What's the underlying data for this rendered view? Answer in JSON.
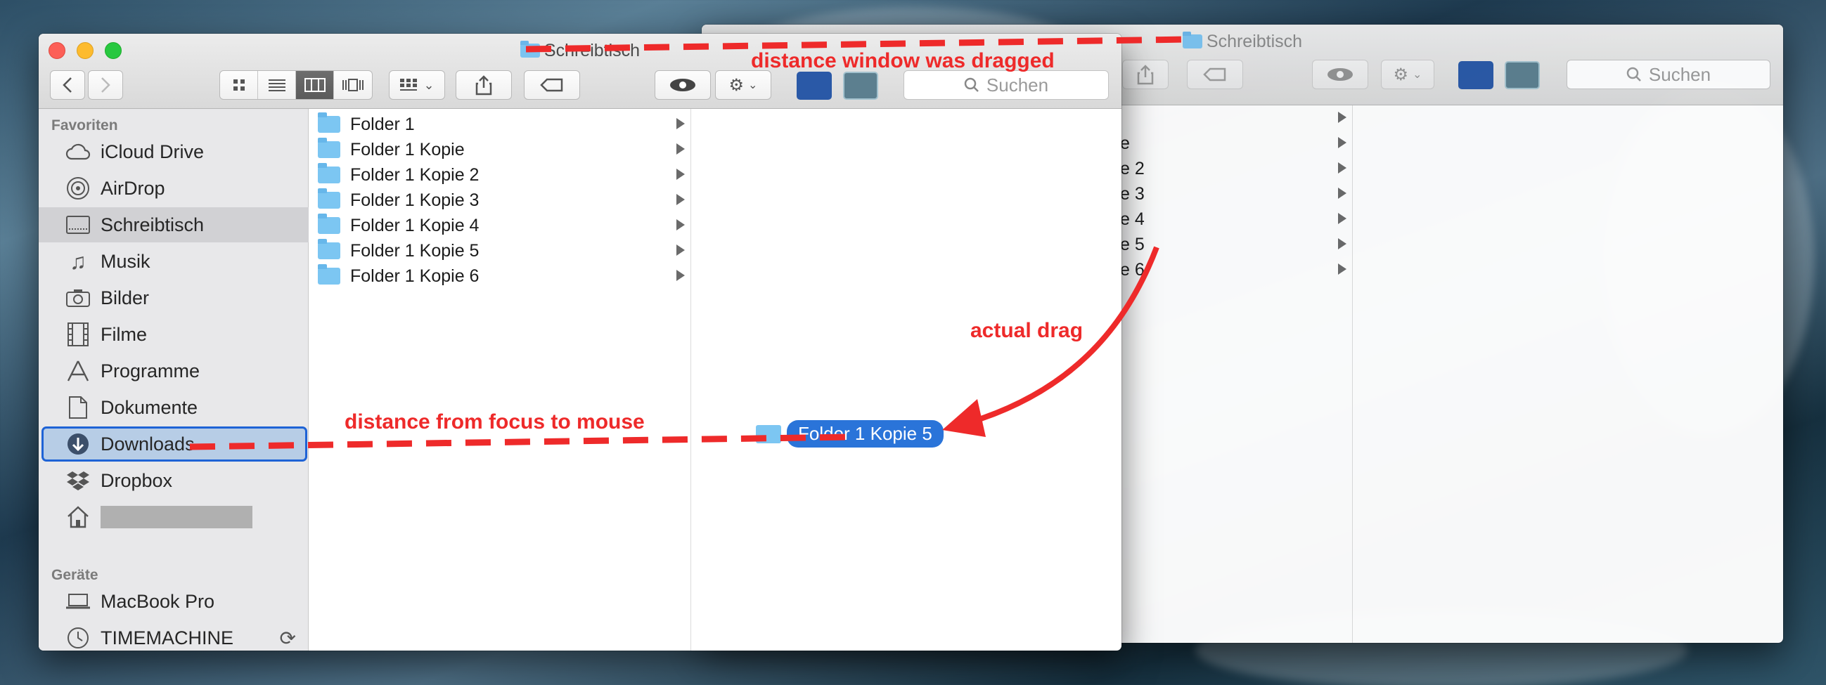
{
  "window": {
    "title": "Schreibtisch",
    "search_placeholder": "Suchen"
  },
  "sidebar": {
    "favorites_heading": "Favoriten",
    "items": [
      {
        "label": "iCloud Drive",
        "icon": "cloud-icon"
      },
      {
        "label": "AirDrop",
        "icon": "airdrop-icon"
      },
      {
        "label": "Schreibtisch",
        "icon": "desktop-icon",
        "selected": true
      },
      {
        "label": "Musik",
        "icon": "music-note-icon"
      },
      {
        "label": "Bilder",
        "icon": "camera-icon"
      },
      {
        "label": "Filme",
        "icon": "film-icon"
      },
      {
        "label": "Programme",
        "icon": "applications-icon"
      },
      {
        "label": "Dokumente",
        "icon": "document-icon"
      },
      {
        "label": "Downloads",
        "icon": "download-icon",
        "drop_target": true
      },
      {
        "label": "Dropbox",
        "icon": "dropbox-icon"
      },
      {
        "label": "",
        "icon": "home-icon",
        "redacted": true
      }
    ],
    "devices_heading": "Geräte",
    "devices": [
      {
        "label": "MacBook Pro",
        "icon": "laptop-icon"
      },
      {
        "label": "TIMEMACHINE",
        "icon": "timemachine-icon"
      }
    ]
  },
  "columns": {
    "folders": [
      "Folder 1",
      "Folder 1 Kopie",
      "Folder 1 Kopie 2",
      "Folder 1 Kopie 3",
      "Folder 1 Kopie 4",
      "Folder 1 Kopie 5",
      "Folder 1 Kopie 6"
    ],
    "ghost_fragments": [
      "e",
      "e 2",
      "e 3",
      "e 4",
      "e 5",
      "e 6"
    ]
  },
  "drag_item": {
    "label": "Folder 1 Kopie 5"
  },
  "annotations": {
    "window_drag": "distance window was dragged",
    "actual_drag": "actual drag",
    "focus_to_mouse": "distance from focus to mouse"
  },
  "colors": {
    "annotation_red": "#ee2a2a",
    "selection_blue": "#2a74d9",
    "folder_blue": "#7cc6f2"
  }
}
